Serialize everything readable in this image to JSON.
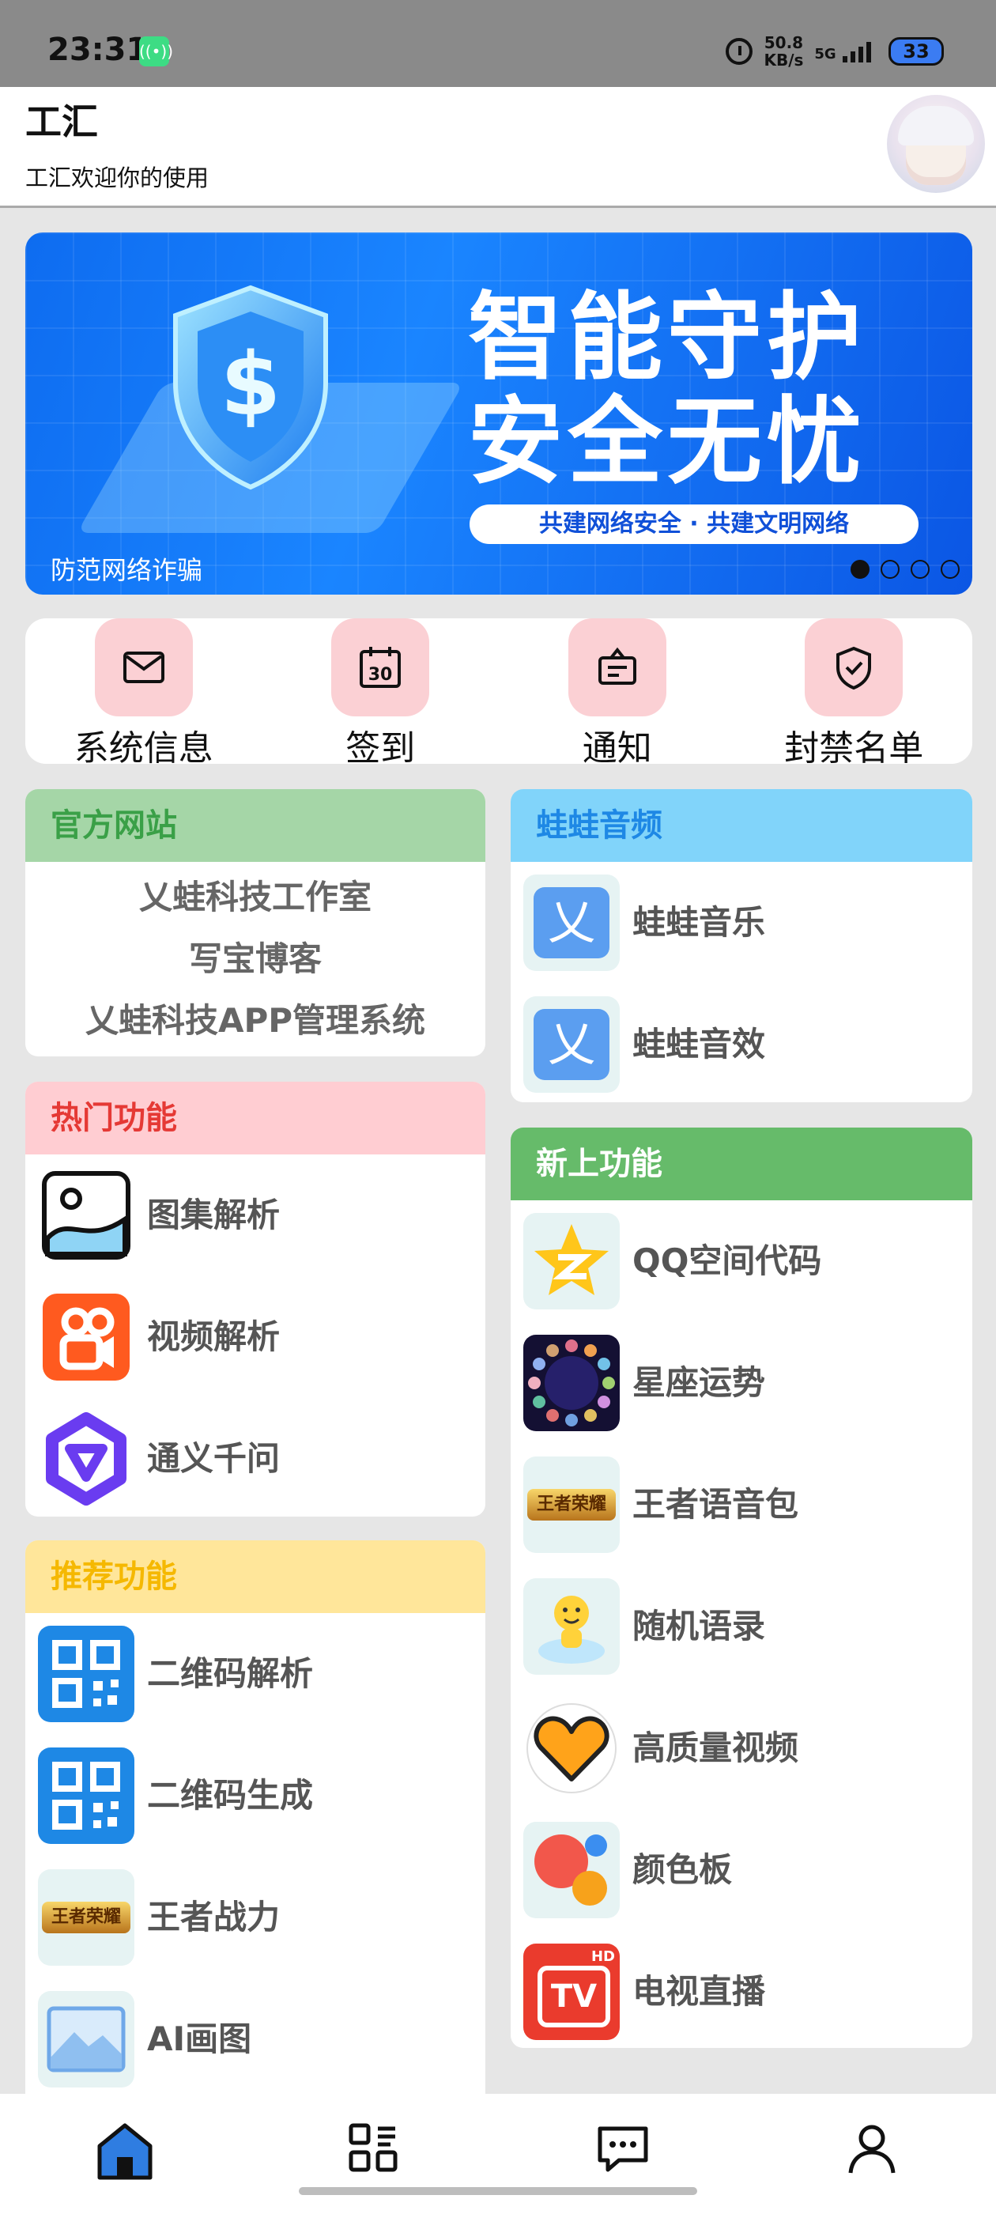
{
  "status_bar": {
    "time": "23:31",
    "net_speed_value": "50.8",
    "net_speed_unit": "KB/s",
    "network": "5G",
    "battery": "33"
  },
  "header": {
    "title": "工汇",
    "subtitle": "工汇欢迎你的使用"
  },
  "banner": {
    "headline_1": "智能守护",
    "headline_2": "安全无忧",
    "slogan": "共建网络安全 · 共建文明网络",
    "caption": "防范网络诈骗",
    "active_index": 0,
    "dot_count": 4
  },
  "quick_actions": [
    {
      "label": "系统信息",
      "icon": "mail-icon"
    },
    {
      "label": "签到",
      "icon": "calendar-icon"
    },
    {
      "label": "通知",
      "icon": "notice-icon"
    },
    {
      "label": "封禁名单",
      "icon": "shield-check-icon"
    }
  ],
  "sections": {
    "official": {
      "title": "官方网站",
      "links": [
        "乂蛙科技工作室",
        "写宝博客",
        "乂蛙科技APP管理系统"
      ]
    },
    "audio": {
      "title": "蛙蛙音频",
      "items": [
        "蛙蛙音乐",
        "蛙蛙音效"
      ]
    },
    "hot": {
      "title": "热门功能",
      "items": [
        "图集解析",
        "视频解析",
        "通义千问"
      ]
    },
    "new": {
      "title": "新上功能",
      "items": [
        "QQ空间代码",
        "星座运势",
        "王者语音包",
        "随机语录",
        "高质量视频",
        "颜色板",
        "电视直播"
      ]
    },
    "recommend": {
      "title": "推荐功能",
      "items": [
        "二维码解析",
        "二维码生成",
        "王者战力",
        "AI画图"
      ]
    }
  },
  "icon_glyphs": {
    "audio": "乂",
    "tv": "TV",
    "tv_badge": "HD",
    "king": "王者荣耀"
  },
  "colors": {
    "accent": "#2f7de1",
    "official_head_bg": "#a5d6a7",
    "official_head_fg": "#3aa047",
    "audio_head_bg": "#81d4fa",
    "audio_head_fg": "#1e88e5",
    "hot_head_bg": "#ffcdd2",
    "hot_head_fg": "#e53935",
    "new_head_bg": "#66bb6a",
    "new_head_fg": "#ffffff",
    "recommend_head_bg": "#ffe69a",
    "recommend_head_fg": "#f5b800",
    "quick_icon_bg": "#fbd0d4"
  },
  "bottom_nav": [
    {
      "icon": "home-icon",
      "active": true
    },
    {
      "icon": "apps-icon",
      "active": false
    },
    {
      "icon": "message-icon",
      "active": false
    },
    {
      "icon": "profile-icon",
      "active": false
    }
  ]
}
